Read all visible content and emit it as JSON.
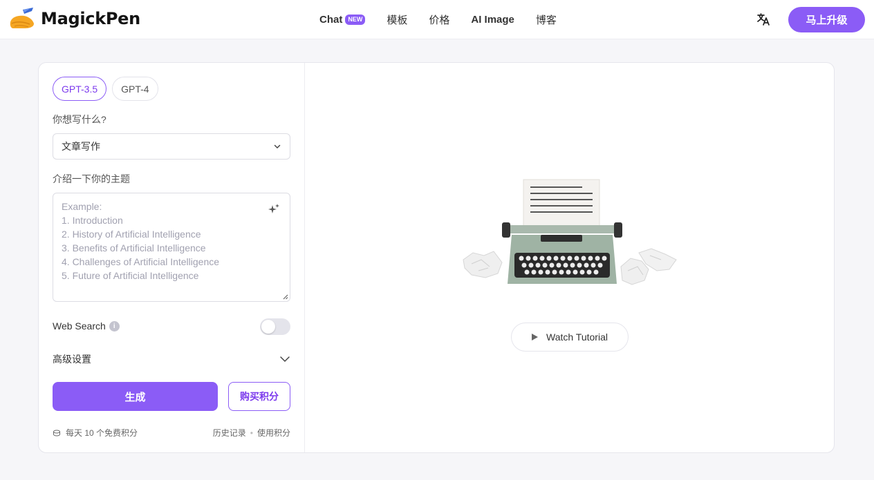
{
  "header": {
    "brand": "MagickPen",
    "nav": [
      {
        "label": "Chat",
        "badge": "NEW"
      },
      {
        "label": "模板"
      },
      {
        "label": "价格"
      },
      {
        "label": "AI Image"
      },
      {
        "label": "博客"
      }
    ],
    "language_icon": "translate-icon",
    "upgrade_label": "马上升级"
  },
  "form": {
    "models": [
      "GPT-3.5",
      "GPT-4"
    ],
    "selected_model": "GPT-3.5",
    "what_label": "你想写什么?",
    "writing_type": "文章写作",
    "topic_label": "介绍一下你的主题",
    "topic_value": "",
    "topic_placeholder": [
      "Example:",
      "1. Introduction",
      "2. History of Artificial Intelligence",
      "3. Benefits of Artificial Intelligence",
      "4. Challenges of Artificial Intelligence",
      "5. Future of Artificial Intelligence"
    ],
    "web_search_label": "Web Search",
    "web_search_enabled": false,
    "advanced_label": "高级设置",
    "generate_label": "生成",
    "buy_label": "购买积分",
    "free_credits": "每天 10 个免费积分",
    "history_label": "历史记录",
    "usage_label": "使用积分"
  },
  "preview": {
    "tutorial_label": "Watch Tutorial"
  },
  "colors": {
    "accent": "#8b5cf6",
    "accent_text": "#7c3aed",
    "background": "#f6f6f9"
  }
}
